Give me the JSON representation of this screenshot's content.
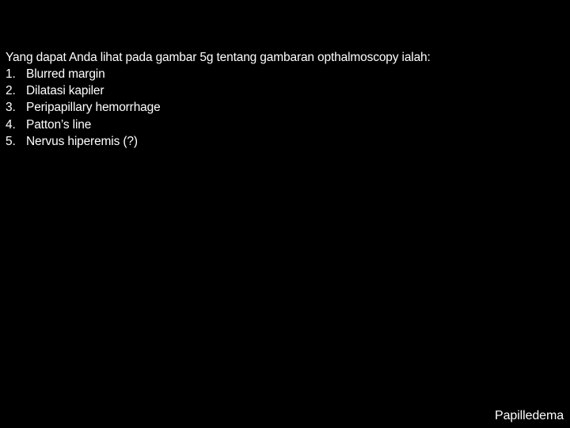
{
  "slide": {
    "background_color": "#000000",
    "text_color": "#ffffff",
    "heading": "Yang dapat Anda lihat pada gambar 5g tentang gambaran opthalmoscopy ialah:",
    "list": [
      {
        "marker": "1.",
        "text": "Blurred margin"
      },
      {
        "marker": "2.",
        "text": "Dilatasi kapiler"
      },
      {
        "marker": "3.",
        "text": "Peripapillary hemorrhage"
      },
      {
        "marker": "4.",
        "text": "Patton’s line"
      },
      {
        "marker": "5.",
        "text": "Nervus hiperemis (?)"
      }
    ],
    "footer_caption": "Papilledema"
  }
}
